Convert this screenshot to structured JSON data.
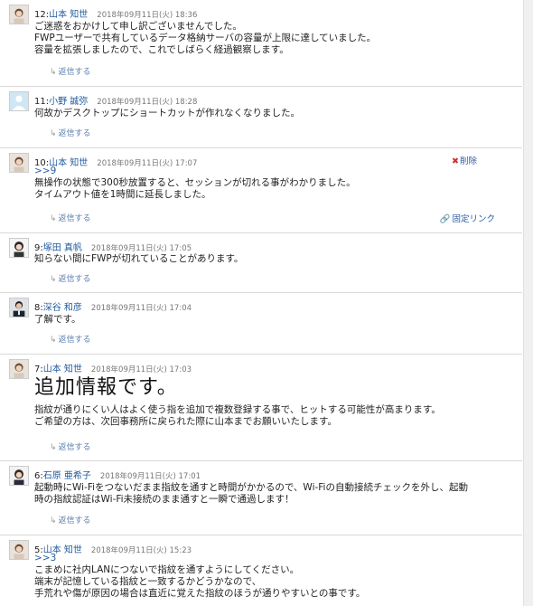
{
  "posts": [
    {
      "num": "12:",
      "author": "山本 知世",
      "date": "2018年09月11日(火) 18:36",
      "lines": [
        "ご迷惑をおかけして申し訳ございませんでした。",
        "FWPユーザーで共有しているデータ格納サーバの容量が上限に達していました。",
        "容量を拡張しましたので、これでしばらく経過観察します。"
      ],
      "reply": "返信する"
    },
    {
      "num": "11:",
      "author": "小野 誠弥",
      "date": "2018年09月11日(火) 18:28",
      "lines": [
        "何故かデスクトップにショートカットが作れなくなりました。"
      ],
      "reply": "返信する"
    },
    {
      "num": "10:",
      "author": "山本 知世",
      "date": "2018年09月11日(火) 17:07",
      "ref": ">>9",
      "lines": [
        "無操作の状態で300秒放置すると、セッションが切れる事がわかりました。",
        "タイムアウト値を1時間に延長しました。"
      ],
      "reply": "返信する",
      "delete": "削除",
      "permalink": "固定リンク"
    },
    {
      "num": "9:",
      "author": "塚田 真帆",
      "date": "2018年09月11日(火) 17:05",
      "lines": [
        "知らない間にFWPが切れていることがあります。"
      ],
      "reply": "返信する"
    },
    {
      "num": "8:",
      "author": "深谷 和彦",
      "date": "2018年09月11日(火) 17:04",
      "lines": [
        "了解です。"
      ],
      "reply": "返信する"
    },
    {
      "num": "7:",
      "author": "山本 知世",
      "date": "2018年09月11日(火) 17:03",
      "big": "追加情報です。",
      "lines": [
        "指紋が通りにくい人はよく使う指を追加で複数登録する事で、ヒットする可能性が高まります。",
        "ご希望の方は、次回事務所に戻られた際に山本までお願いいたします。"
      ],
      "reply": "返信する"
    },
    {
      "num": "6:",
      "author": "石原 亜希子",
      "date": "2018年09月11日(火) 17:01",
      "lines": [
        "起動時にWi-Fiをつないだまま指紋を通すと時間がかかるので、Wi-Fiの自動接続チェックを外し、起動",
        "時の指紋認証はWi-Fi未接続のまま通すと一瞬で通過します！"
      ],
      "reply": "返信する"
    },
    {
      "num": "5:",
      "author": "山本 知世",
      "date": "2018年09月11日(火) 15:23",
      "ref": ">>3",
      "lines": [
        "こまめに社内LANにつないで指紋を通すようにしてください。",
        "端末が記憶している指紋と一致するかどうかなので、",
        "手荒れや傷が原因の場合は直近に覚えた指紋のほうが通りやすいとの事です。"
      ]
    }
  ]
}
